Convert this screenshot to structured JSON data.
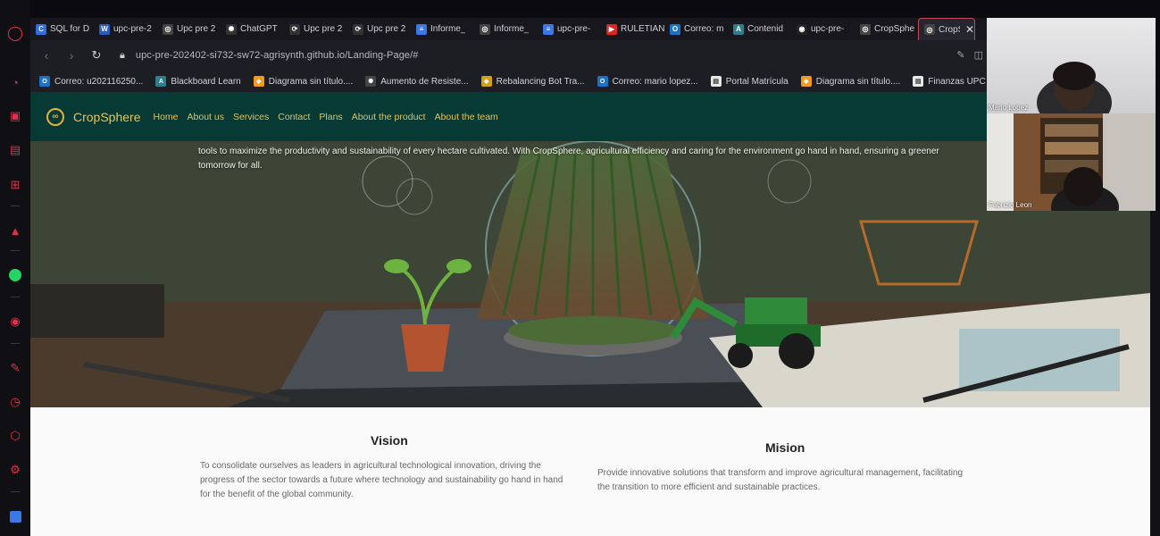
{
  "browser": {
    "tabs": [
      {
        "label": "SQL for D",
        "icon": "c-icon",
        "color": "#2f6fe0",
        "glyph": "C"
      },
      {
        "label": "upc-pre-2",
        "icon": "word-icon",
        "color": "#2b5cbf",
        "glyph": "W"
      },
      {
        "label": "Upc pre 2",
        "icon": "globe-icon",
        "color": "#444",
        "glyph": "◎"
      },
      {
        "label": "ChatGPT",
        "icon": "chatgpt-icon",
        "color": "#333",
        "glyph": "✺"
      },
      {
        "label": "Upc pre 2",
        "icon": "sync-icon",
        "color": "#333",
        "glyph": "⟳"
      },
      {
        "label": "Upc pre 2",
        "icon": "sync-icon",
        "color": "#333",
        "glyph": "⟳"
      },
      {
        "label": "Informe_",
        "icon": "docs-icon",
        "color": "#3b78e7",
        "glyph": "≡"
      },
      {
        "label": "Informe_",
        "icon": "globe-icon",
        "color": "#444",
        "glyph": "◎"
      },
      {
        "label": "upc-pre-",
        "icon": "docs-icon",
        "color": "#3b78e7",
        "glyph": "≡"
      },
      {
        "label": "RULETIAN",
        "icon": "youtube-icon",
        "color": "#e02424",
        "glyph": "▶"
      },
      {
        "label": "Correo: m",
        "icon": "outlook-icon",
        "color": "#1a73c9",
        "glyph": "O"
      },
      {
        "label": "Contenid",
        "icon": "blackboard-icon",
        "color": "#2d7f8a",
        "glyph": "A"
      },
      {
        "label": "upc-pre-",
        "icon": "github-icon",
        "color": "#222",
        "glyph": "◉"
      },
      {
        "label": "CropSphe",
        "icon": "globe-icon",
        "color": "#444",
        "glyph": "◎"
      },
      {
        "label": "CropS",
        "icon": "globe-icon",
        "color": "#444",
        "glyph": "◎",
        "active": true
      }
    ],
    "close_glyph": "✕",
    "url": "upc-pre-202402-si732-sw72-agrisynth.github.io/Landing-Page/#",
    "back": "‹",
    "forward": "›",
    "reload": "↻",
    "lock": "🔒",
    "bookmarks": [
      {
        "label": "Correo: u202116250...",
        "color": "#1a73c9",
        "glyph": "O"
      },
      {
        "label": "Blackboard Learn",
        "color": "#2d7f8a",
        "glyph": "A"
      },
      {
        "label": "Diagrama sin título....",
        "color": "#f29a1f",
        "glyph": "◈"
      },
      {
        "label": "Aumento de Resiste...",
        "color": "#444",
        "glyph": "✺"
      },
      {
        "label": "Rebalancing Bot Tra...",
        "color": "#d4a017",
        "glyph": "◆"
      },
      {
        "label": "Correo: mario lopez...",
        "color": "#1a73c9",
        "glyph": "O"
      },
      {
        "label": "Portal Matrícula",
        "color": "#e8e8e8",
        "glyph": "▤"
      },
      {
        "label": "Diagrama sin título....",
        "color": "#f29a1f",
        "glyph": "◈"
      },
      {
        "label": "Finanzas UPC",
        "color": "#e8e8e8",
        "glyph": "▤"
      }
    ]
  },
  "site": {
    "brand": "CropSphere",
    "nav": [
      "Home",
      "About us",
      "Services",
      "Contact",
      "Plans",
      "About the product",
      "About the team"
    ],
    "hero_text": "tools to maximize the productivity and sustainability of every hectare cultivated. With CropSphere, agricultural efficiency and caring for the environment go hand in hand, ensuring a greener tomorrow for all.",
    "vision_title": "Vision",
    "vision_text": "To consolidate ourselves as leaders in agricultural technological innovation, driving the progress of the sector towards a future where technology and sustainability go hand in hand for the benefit of the global community.",
    "mision_title": "Mision",
    "mision_text": "Provide innovative solutions that transform and improve agricultural management, facilitating the transition to more efficient and sustainable practices."
  },
  "call": {
    "participants": [
      {
        "name": "Mario Lopez"
      },
      {
        "name": "Fabrizio Leon"
      }
    ]
  },
  "sidebar_icons": [
    "opera-icon",
    "speed-dial-icon",
    "shopping-icon",
    "twitch-icon",
    "ai-icon",
    "aria-icon",
    "whatsapp-icon",
    "player-icon",
    "pinboard-icon",
    "history-icon",
    "extensions-icon",
    "settings-icon",
    "translate-icon"
  ]
}
